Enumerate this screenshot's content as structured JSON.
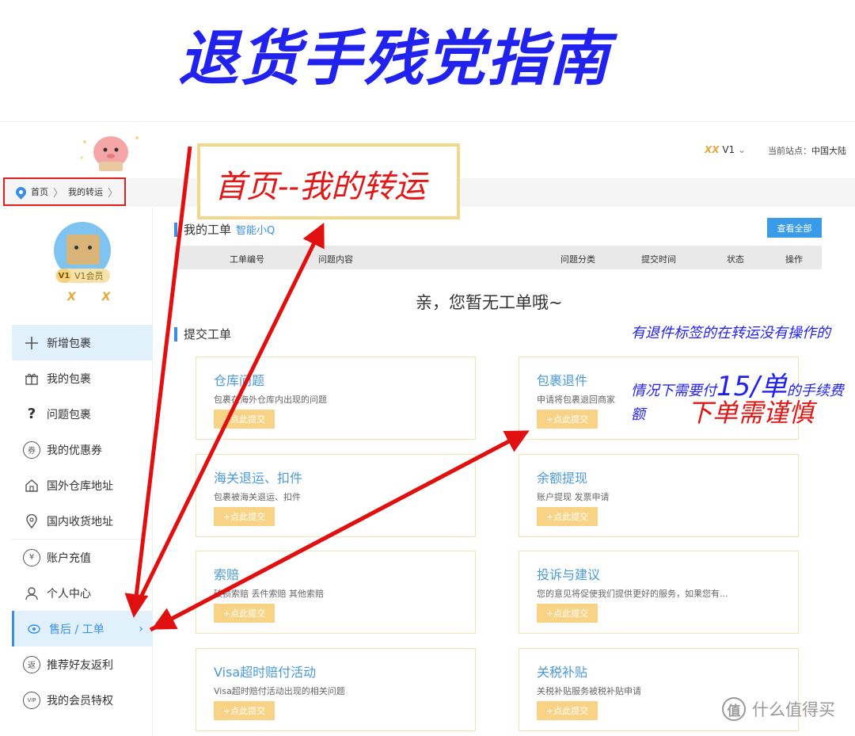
{
  "headline": "退货手残党指南",
  "header": {
    "user_name": "XX",
    "level": "V1",
    "station_label": "当前站点：",
    "station_value": "中国大陆"
  },
  "breadcrumb": {
    "home": "首页",
    "current": "我的转运"
  },
  "callout": "首页--我的转运",
  "profile": {
    "badge": "V1",
    "member_label": "V1会员",
    "name": "X X"
  },
  "sidebar": {
    "items": [
      {
        "label": "新增包裹",
        "icon": "plus-icon"
      },
      {
        "label": "我的包裹",
        "icon": "gift-icon"
      },
      {
        "label": "问题包裹",
        "icon": "question-icon"
      },
      {
        "label": "我的优惠券",
        "icon": "coupon-icon",
        "glyph": "券"
      },
      {
        "label": "国外仓库地址",
        "icon": "warehouse-icon"
      },
      {
        "label": "国内收货地址",
        "icon": "location-icon"
      },
      {
        "label": "账户充值",
        "icon": "yen-icon",
        "glyph": "¥"
      },
      {
        "label": "个人中心",
        "icon": "user-icon"
      },
      {
        "label": "售后 / 工单",
        "icon": "service-icon"
      },
      {
        "label": "推荐好友返利",
        "icon": "rebate-icon",
        "glyph": "返"
      },
      {
        "label": "我的会员特权",
        "icon": "vip-icon",
        "glyph": "VIP"
      }
    ]
  },
  "tickets": {
    "title": "我的工单",
    "subtitle": "智能小Q",
    "view_all": "查看全部",
    "columns": [
      "工单编号",
      "问题内容",
      "问题分类",
      "提交时间",
      "状态",
      "操作"
    ],
    "empty_text": "亲，您暂无工单哦~"
  },
  "submit": {
    "title": "提交工单",
    "button_label": "+点此提交",
    "cards": [
      {
        "title": "仓库问题",
        "desc": "包裹在海外仓库内出现的问题"
      },
      {
        "title": "包裹退件",
        "desc": "申请将包裹退回商家"
      },
      {
        "title": "海关退运、扣件",
        "desc": "包裹被海关退运、扣件"
      },
      {
        "title": "余额提现",
        "desc": "账户提现 发票申请"
      },
      {
        "title": "索赔",
        "desc": "破损索赔 丢件索赔 其他索赔"
      },
      {
        "title": "投诉与建议",
        "desc": "您的意见将促使我们提供更好的服务，如果您有..."
      },
      {
        "title": "Visa超时赔付活动",
        "desc": "Visa超时赔付活动出现的相关问题"
      },
      {
        "title": "关税补贴",
        "desc": "关税补贴服务被税补贴申请"
      }
    ]
  },
  "annotations": {
    "line1": "有退件标签的在转运没有操作的",
    "line2_prefix": "情况下需要付",
    "line2_amount": "15/单",
    "line2_suffix": "的手续费额",
    "line3": "下单需谨慎"
  },
  "watermark": {
    "logo_glyph": "值",
    "text": "什么值得买"
  },
  "colors": {
    "accent": "#3a8ee6",
    "headline": "#2222ee",
    "annotation_red": "#e01818",
    "card_button": "#f8d385"
  }
}
